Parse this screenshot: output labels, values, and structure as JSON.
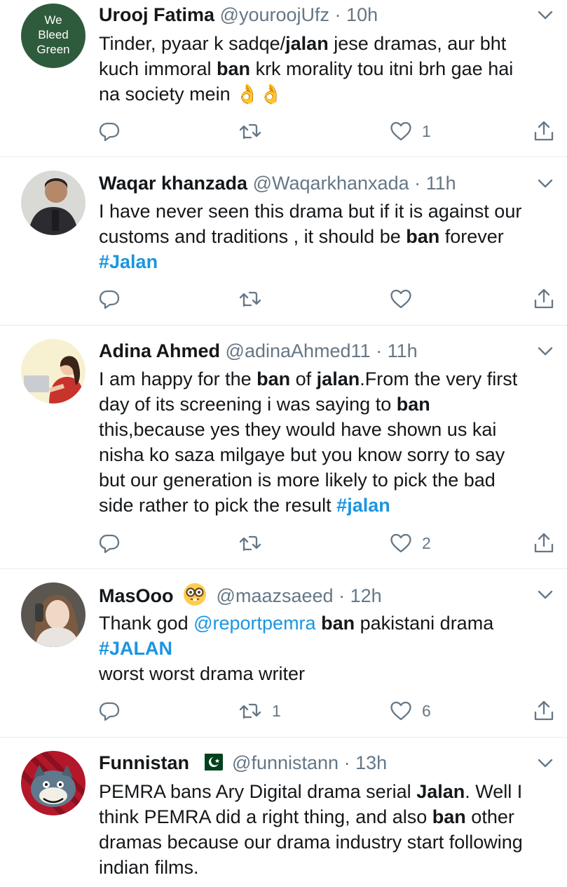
{
  "tweets": [
    {
      "name": "Urooj Fatima",
      "handle": "@youroojUfz",
      "time": "10h",
      "avatar_text": [
        "We",
        "Bleed",
        "Green"
      ],
      "avatar_color": "#2f5b3d",
      "lines": [
        [
          {
            "t": "Tinder, pyaar k sadqe/"
          },
          {
            "t": "jalan",
            "b": true
          },
          {
            "t": " jese dramas, aur bht"
          }
        ],
        [
          {
            "t": "kuch immoral "
          },
          {
            "t": "ban",
            "b": true
          },
          {
            "t": " krk morality tou itni brh gae hai"
          }
        ],
        [
          {
            "t": "na society mein "
          },
          {
            "t": "👌👌",
            "emoji": true
          }
        ]
      ],
      "replies": "",
      "retweets": "",
      "likes": "1"
    },
    {
      "name": "Waqar khanzada",
      "handle": "@Waqarkhanxada",
      "time": "11h",
      "lines": [
        [
          {
            "t": "I have never seen this drama but if it is against our"
          }
        ],
        [
          {
            "t": "customs and traditions , it should be "
          },
          {
            "t": "ban",
            "b": true
          },
          {
            "t": " forever"
          }
        ],
        [
          {
            "t": "#Jalan",
            "link": true
          }
        ]
      ],
      "replies": "",
      "retweets": "",
      "likes": ""
    },
    {
      "name": "Adina Ahmed",
      "handle": "@adinaAhmed11",
      "time": "11h",
      "lines": [
        [
          {
            "t": "I am happy for the "
          },
          {
            "t": "ban",
            "b": true
          },
          {
            "t": " of "
          },
          {
            "t": "jalan",
            "b": true
          },
          {
            "t": ".From the very first"
          }
        ],
        [
          {
            "t": "day of its screening i was saying to "
          },
          {
            "t": "ban",
            "b": true
          }
        ],
        [
          {
            "t": "this,because yes they would have shown us kai"
          }
        ],
        [
          {
            "t": "nisha ko saza milgaye but you know sorry to say"
          }
        ],
        [
          {
            "t": "but our generation is more likely to pick the bad"
          }
        ],
        [
          {
            "t": "side rather to pick the result "
          },
          {
            "t": "#jalan",
            "link": true
          }
        ]
      ],
      "replies": "",
      "retweets": "",
      "likes": "2"
    },
    {
      "name": "MasOoo",
      "handle": "@maazsaeed",
      "time": "12h",
      "lines": [
        [
          {
            "t": "Thank god "
          },
          {
            "t": "@reportpemra",
            "mention": true
          },
          {
            "t": " "
          },
          {
            "t": "ban",
            "b": true
          },
          {
            "t": " pakistani drama"
          }
        ],
        [
          {
            "t": "#JALAN",
            "link": true
          }
        ],
        [
          {
            "t": "worst worst drama writer"
          }
        ]
      ],
      "replies": "",
      "retweets": "1",
      "likes": "6"
    },
    {
      "name": "Funnistan",
      "handle": "@funnistann",
      "time": "13h",
      "lines": [
        [
          {
            "t": "PEMRA bans Ary Digital drama serial "
          },
          {
            "t": "Jalan",
            "b": true
          },
          {
            "t": ". Well I"
          }
        ],
        [
          {
            "t": "think PEMRA did a right thing, and also "
          },
          {
            "t": "ban",
            "b": true
          },
          {
            "t": " other"
          }
        ],
        [
          {
            "t": "dramas because our drama industry start following"
          }
        ],
        [
          {
            "t": "indian films."
          }
        ]
      ],
      "replies": "",
      "retweets": "",
      "likes": ""
    }
  ],
  "separator": "·",
  "colors": {
    "text": "#14171a",
    "secondary": "#657786",
    "link": "#1b95e0",
    "divider": "#e6ecf0"
  }
}
